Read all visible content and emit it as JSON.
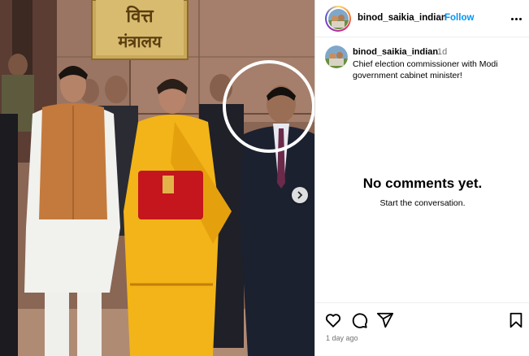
{
  "photo": {
    "sign_line1": "वित्त",
    "sign_line2": "मंत्रालय"
  },
  "header": {
    "username": "binod_saikia_indian",
    "separator": "•",
    "follow_label": "Follow"
  },
  "caption": {
    "username": "binod_saikia_indian",
    "time": "1d",
    "text": "Chief election commissioner with Modi government cabinet minister!"
  },
  "comments": {
    "empty_title": "No comments yet.",
    "empty_subtitle": "Start the conversation."
  },
  "footer": {
    "time_ago": "1 day ago"
  },
  "icons": {
    "like": "heart-icon",
    "comment": "comment-icon",
    "share": "send-icon",
    "save": "bookmark-icon",
    "next": "chevron-right-icon",
    "more": "more-horizontal-icon"
  },
  "colors": {
    "follow": "#0095f6",
    "muted": "#737373",
    "saree": "#f2b418",
    "briefcase": "#c4161c"
  }
}
